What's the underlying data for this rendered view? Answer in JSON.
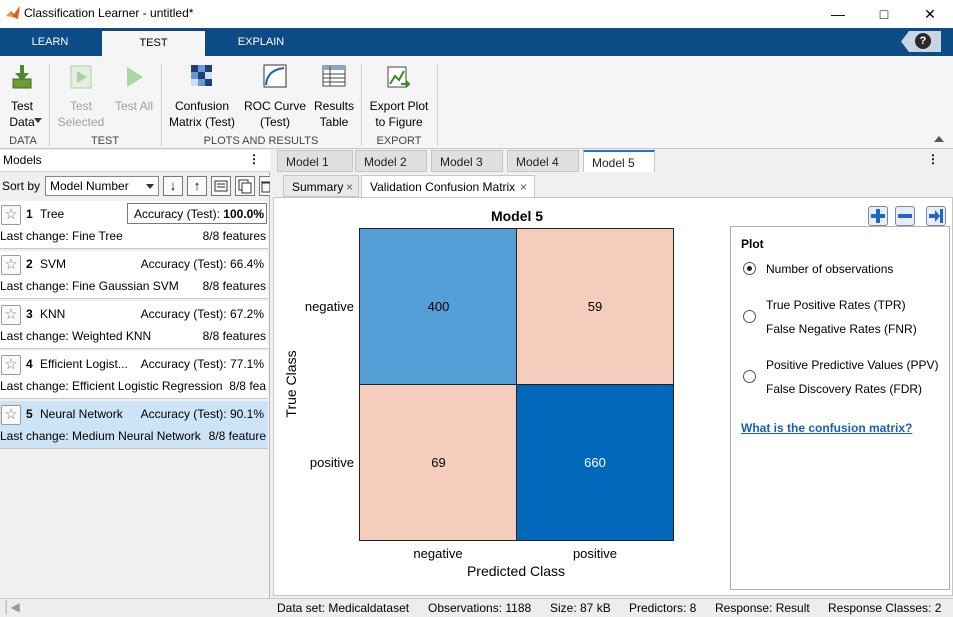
{
  "window": {
    "title": "Classification Learner - untitled*"
  },
  "ribbon": {
    "tabs": [
      "LEARN",
      "TEST",
      "EXPLAIN"
    ],
    "buttons": {
      "test_data": "Test\nData",
      "test_selected": "Test\nSelected",
      "test_all": "Test All",
      "confusion": "Confusion\nMatrix (Test)",
      "roc": "ROC Curve\n(Test)",
      "results": "Results\nTable",
      "export": "Export Plot\nto Figure"
    },
    "groups": {
      "data": "DATA",
      "test": "TEST",
      "plots": "PLOTS AND RESULTS",
      "export": "EXPORT"
    }
  },
  "models_panel": {
    "title": "Models",
    "sort_label": "Sort by",
    "sort_value": "Model Number",
    "items": [
      {
        "num": "1",
        "name": "Tree",
        "accuracy_label": "Accuracy (Test):",
        "accuracy": "100.0%",
        "last_change": "Last change: Fine Tree",
        "features": "8/8 features"
      },
      {
        "num": "2",
        "name": "SVM",
        "accuracy_label": "Accuracy (Test):",
        "accuracy": "66.4%",
        "last_change": "Last change: Fine Gaussian SVM",
        "features": "8/8 features"
      },
      {
        "num": "3",
        "name": "KNN",
        "accuracy_label": "Accuracy (Test):",
        "accuracy": "67.2%",
        "last_change": "Last change: Weighted KNN",
        "features": "8/8 features"
      },
      {
        "num": "4",
        "name": "Efficient Logist...",
        "accuracy_label": "Accuracy (Test):",
        "accuracy": "77.1%",
        "last_change": "Last change: Efficient Logistic Regression",
        "features": "8/8 fea"
      },
      {
        "num": "5",
        "name": "Neural Network",
        "accuracy_label": "Accuracy (Test):",
        "accuracy": "90.1%",
        "last_change": "Last change: Medium Neural Network",
        "features": "8/8 feature"
      }
    ]
  },
  "model_tabs": [
    "Model 1",
    "Model 2",
    "Model 3",
    "Model 4",
    "Model 5"
  ],
  "sub_tabs": [
    "Summary",
    "Validation Confusion Matrix"
  ],
  "confusion": {
    "title": "Model 5",
    "ylabel": "True Class",
    "xlabel": "Predicted Class",
    "classes": [
      "negative",
      "positive"
    ],
    "cells": [
      [
        "400",
        "59"
      ],
      [
        "69",
        "660"
      ]
    ]
  },
  "plot_options": {
    "title": "Plot",
    "opt1": "Number of observations",
    "opt2a": "True Positive Rates (TPR)",
    "opt2b": "False Negative Rates (FNR)",
    "opt3a": "Positive Predictive Values (PPV)",
    "opt3b": "False Discovery Rates (FDR)",
    "link": "What is the confusion matrix?"
  },
  "status": {
    "dataset": "Data set: Medicaldataset",
    "observations": "Observations: 1188",
    "size": "Size: 87 kB",
    "predictors": "Predictors: 8",
    "response": "Response: Result",
    "classes": "Response Classes: 2"
  }
}
